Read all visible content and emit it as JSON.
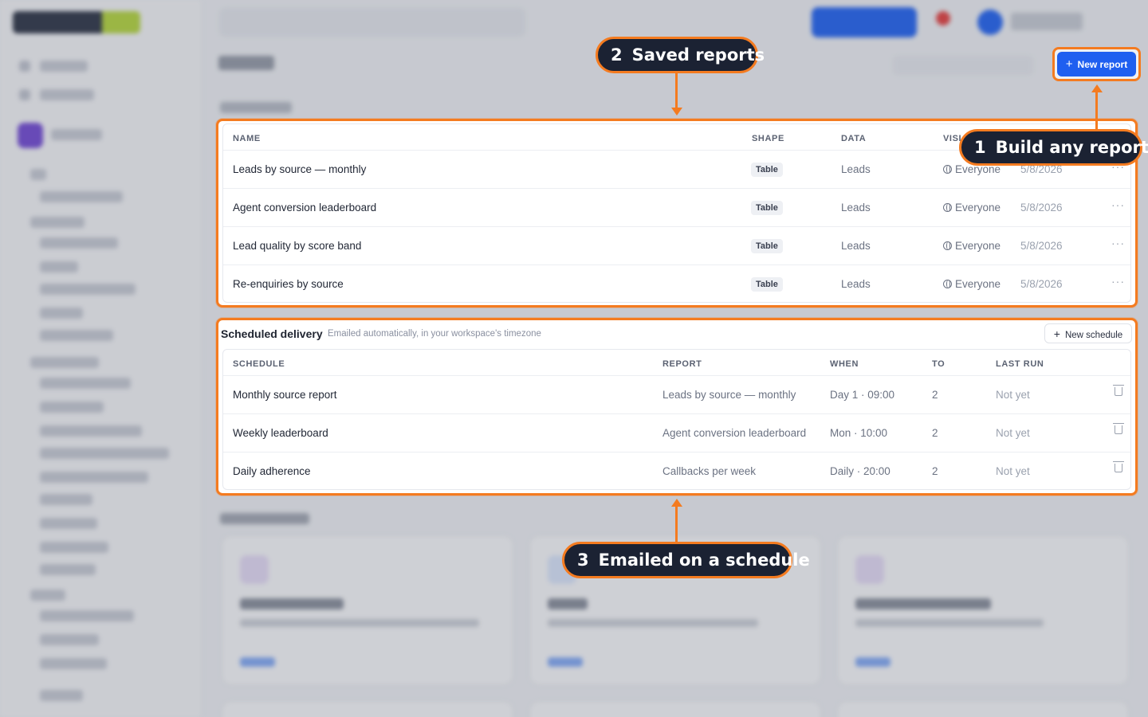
{
  "callouts": {
    "build": {
      "num": "1",
      "text": "Build any report"
    },
    "saved": {
      "num": "2",
      "text": "Saved reports"
    },
    "scheduled": {
      "num": "3",
      "text": "Emailed on a schedule"
    }
  },
  "toolbar": {
    "new_report_label": "New report",
    "new_report_icon": "plus-icon"
  },
  "saved_reports": {
    "columns": [
      "NAME",
      "SHAPE",
      "DATA",
      "VISI"
    ],
    "rows": [
      {
        "name": "Leads by source — monthly",
        "shape": "Table",
        "data": "Leads",
        "visibility": "Everyone",
        "date": "5/8/2026",
        "menu": "···"
      },
      {
        "name": "Agent conversion leaderboard",
        "shape": "Table",
        "data": "Leads",
        "visibility": "Everyone",
        "date": "5/8/2026",
        "menu": "···"
      },
      {
        "name": "Lead quality by score band",
        "shape": "Table",
        "data": "Leads",
        "visibility": "Everyone",
        "date": "5/8/2026",
        "menu": "···"
      },
      {
        "name": "Re-enquiries by source",
        "shape": "Table",
        "data": "Leads",
        "visibility": "Everyone",
        "date": "5/8/2026",
        "menu": "···"
      }
    ]
  },
  "scheduled_delivery": {
    "title": "Scheduled delivery",
    "subtitle": "Emailed automatically, in your workspace's timezone",
    "new_schedule_label": "New schedule",
    "columns": [
      "SCHEDULE",
      "REPORT",
      "WHEN",
      "TO",
      "LAST RUN"
    ],
    "rows": [
      {
        "schedule": "Monthly source report",
        "report": "Leads by source — monthly",
        "when": "Day 1 · 09:00",
        "to": "2",
        "last_run": "Not yet"
      },
      {
        "schedule": "Weekly leaderboard",
        "report": "Agent conversion leaderboard",
        "when": "Mon · 10:00",
        "to": "2",
        "last_run": "Not yet"
      },
      {
        "schedule": "Daily adherence",
        "report": "Callbacks per week",
        "when": "Daily · 20:00",
        "to": "2",
        "last_run": "Not yet"
      }
    ]
  },
  "colors": {
    "accent": "#f47b20",
    "primary_button": "#1f5ff0",
    "callout_bg": "#1b2233"
  }
}
